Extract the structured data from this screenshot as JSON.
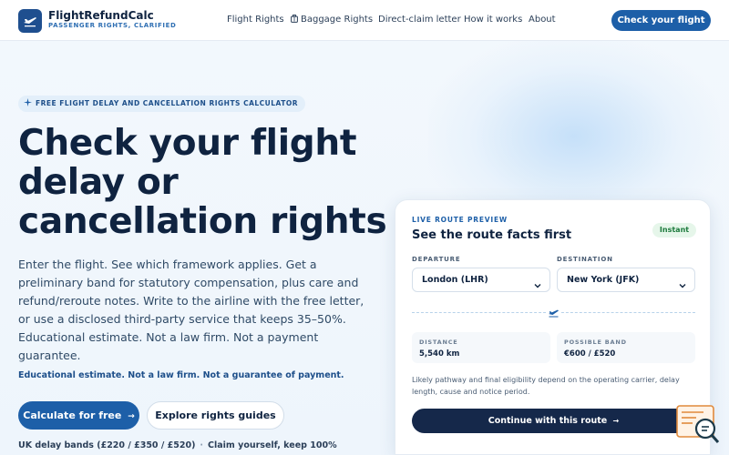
{
  "brand": {
    "name": "FlightRefundCalc",
    "tagline": "PASSENGER RIGHTS, CLARIFIED",
    "logo_icon": "plane-icon"
  },
  "nav": {
    "items": [
      {
        "label": "Flight Rights"
      },
      {
        "label": "Baggage Rights",
        "icon": "luggage-icon"
      },
      {
        "label": "Direct-claim letter"
      },
      {
        "label": "How it works"
      },
      {
        "label": "About"
      }
    ],
    "cta_label": "Check your flight"
  },
  "hero": {
    "eyebrow": "FREE FLIGHT DELAY AND CANCELLATION RIGHTS CALCULATOR",
    "eyebrow_icon": "sparkle-icon",
    "title": "Check your flight delay or cancellation rights",
    "description": "Enter the flight. See which framework applies. Get a preliminary band for statutory compensation, plus care and refund/reroute notes. Write to the airline with the free letter, or use a disclosed third-party service that keeps 35–50%. Educational estimate. Not a law firm. Not a payment guarantee.",
    "disclaimer": "Educational estimate. Not a law firm. Not a guarantee of payment.",
    "primary_label": "Calculate for free",
    "primary_arrow": "→",
    "secondary_label": "Explore rights guides",
    "trust": [
      "UK delay bands (£220 / £350 / £520)",
      "Claim yourself, keep 100%"
    ]
  },
  "card": {
    "eyebrow": "LIVE ROUTE PREVIEW",
    "title": "See the route facts first",
    "badge": "Instant",
    "departure_label": "DEPARTURE",
    "departure_value": "London (LHR)",
    "destination_label": "DESTINATION",
    "destination_value": "New York (JFK)",
    "distance_label": "DISTANCE",
    "distance_value": "5,540 km",
    "band_label": "POSSIBLE BAND",
    "band_value": "€600 / £520",
    "note": "Likely pathway and final eligibility depend on the operating carrier, delay length, cause and notice period.",
    "cta_label": "Continue with this route",
    "cta_arrow": "→"
  },
  "colors": {
    "accent": "#1d5fa8",
    "navy": "#0f2340",
    "dark_cta": "#15284a",
    "success": "#1c7a3c"
  }
}
